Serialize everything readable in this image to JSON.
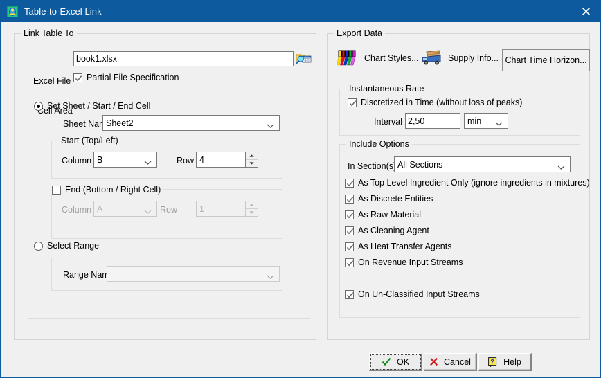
{
  "window": {
    "title": "Table-to-Excel Link",
    "app_icon": "app-icon",
    "close_label": "✕",
    "titlebar_color": "#0d5a9e",
    "face_color": "#f0f0f0"
  },
  "link_table_to": {
    "group_title": "Link Table To",
    "excel_file_label": "Excel File",
    "excel_file_value": "book1.xlsx",
    "excel_file_placeholder": "",
    "browse_icon": "browse-excel-icon",
    "partial_file_label": "Partial File Specification",
    "partial_file_checked": true,
    "cell_area": {
      "group_title": "Cell Area",
      "mode_set_label": "Set Sheet / Start / End Cell",
      "mode_set_selected": true,
      "sheet_name_label": "Sheet Name",
      "sheet_name_value": "Sheet2",
      "start": {
        "group_title": "Start (Top/Left)",
        "column_label": "Column",
        "column_value": "B",
        "row_label": "Row",
        "row_value": "4"
      },
      "end": {
        "check_label": "End  (Bottom / Right Cell)",
        "checked": false,
        "column_label": "Column",
        "column_value": "A",
        "row_label": "Row",
        "row_value": "1",
        "enabled": false
      },
      "mode_range_label": "Select Range",
      "mode_range_selected": false,
      "range_name_label": "Range Name",
      "range_name_value": ""
    }
  },
  "export_data": {
    "group_title": "Export Data",
    "chart_styles_label": "Chart Styles...",
    "chart_styles_icon": "chart-styles-icon",
    "supply_info_label": "Supply Info...",
    "supply_info_icon": "supply-truck-icon",
    "chart_time_horizon_label": "Chart Time Horizon...",
    "instantaneous_rate": {
      "group_title": "Instantaneous Rate",
      "discretized_label": "Discretized in Time  (without loss of peaks)",
      "discretized_checked": true,
      "interval_label": "Interval",
      "interval_value": "2,50",
      "interval_unit": "min"
    },
    "include_options": {
      "group_title": "Include Options",
      "in_sections_label": "In Section(s)",
      "in_sections_value": "All Sections",
      "checkboxes": [
        {
          "label": "As Top Level Ingredient Only (ignore ingredients in mixtures)",
          "checked": true
        },
        {
          "label": "As Discrete Entities",
          "checked": true
        },
        {
          "label": "As Raw Material",
          "checked": true
        },
        {
          "label": "As Cleaning Agent",
          "checked": true
        },
        {
          "label": "As Heat Transfer Agents",
          "checked": true
        },
        {
          "label": "On Revenue Input Streams",
          "checked": true
        },
        {
          "label": "On Un-Classified Input Streams",
          "checked": true
        }
      ]
    }
  },
  "footer": {
    "ok_label": "OK",
    "cancel_label": "Cancel",
    "help_label": "Help",
    "ok_icon": "green-check-icon",
    "cancel_icon": "red-x-icon",
    "help_icon": "help-question-icon"
  }
}
